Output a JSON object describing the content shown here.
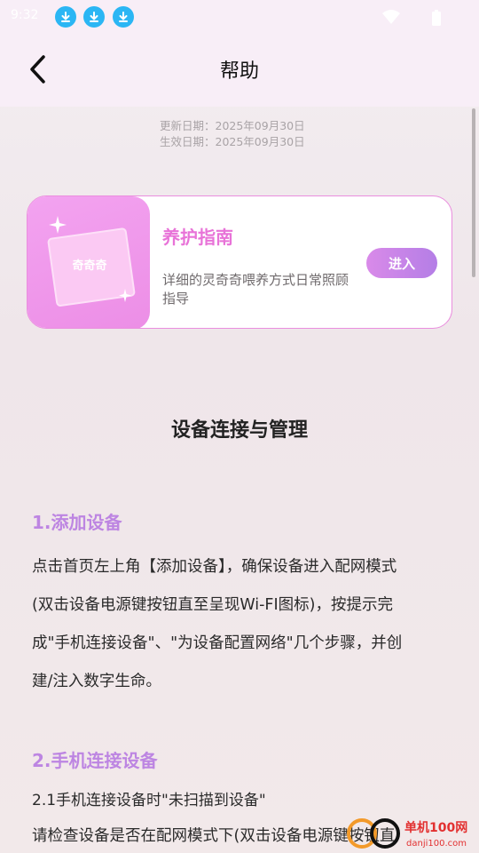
{
  "status_bar": {
    "time": "9:32",
    "icons": [
      "download-icon",
      "download-icon",
      "download-icon",
      "wifi-icon",
      "battery-icon"
    ]
  },
  "header": {
    "title": "帮助",
    "back_icon": "chevron-left-icon"
  },
  "dates": {
    "updated": "更新日期：2025年09月30日",
    "effective": "生效日期：2025年09月30日"
  },
  "card": {
    "image_label": "奇奇奇",
    "title": "养护指南",
    "description": "详细的灵奇奇喂养方式日常照顾指导",
    "enter_label": "进入"
  },
  "content": {
    "section_title": "设备连接与管理",
    "s1_heading": "1.添加设备",
    "s1_lines": [
      "点击首页左上角【添加设备】，确保设备进入配网模式",
      "(双击设备电源键按钮直至呈现Wi-FI图标)，按提示完",
      "成\"手机连接设备\"、\"为设备配置网络\"几个步骤，并创",
      "建/注入数字生命。"
    ],
    "s2_heading": "2.手机连接设备",
    "s2_sub": "2.1手机连接设备时\"未扫描到设备\"",
    "s2_line": "请检查设备是否在配网模式下(双击设备电源键按钮直"
  },
  "watermark": {
    "text": "单机100网",
    "url": "danji100.com"
  },
  "colors": {
    "accent_pink": "#e873d8",
    "heading_purple": "#bd85e2",
    "header_bg": "#f8eef7"
  }
}
